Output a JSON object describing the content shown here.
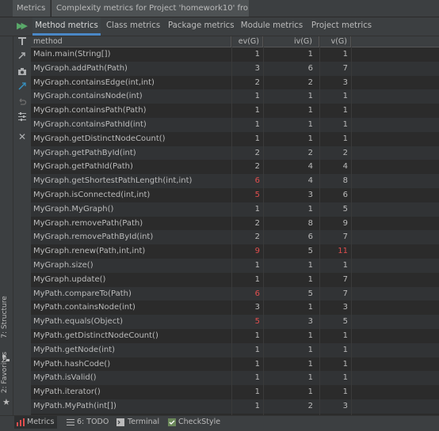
{
  "window_tabs": [
    {
      "label": "Metrics"
    },
    {
      "label": "Complexity metrics for Project 'homework10' fro..."
    }
  ],
  "metric_tabs": [
    {
      "label": "Method metrics",
      "active": true
    },
    {
      "label": "Class metrics"
    },
    {
      "label": "Package metrics"
    },
    {
      "label": "Module metrics"
    },
    {
      "label": "Project metrics"
    }
  ],
  "table": {
    "columns": [
      "method",
      "ev(G)",
      "iv(G)",
      "v(G)"
    ],
    "rows": [
      {
        "method": "Main.main(String[])",
        "ev": "1",
        "iv": "1",
        "v": "1"
      },
      {
        "method": "MyGraph.addPath(Path)",
        "ev": "3",
        "iv": "6",
        "v": "7"
      },
      {
        "method": "MyGraph.containsEdge(int,int)",
        "ev": "2",
        "iv": "2",
        "v": "3"
      },
      {
        "method": "MyGraph.containsNode(int)",
        "ev": "1",
        "iv": "1",
        "v": "1"
      },
      {
        "method": "MyGraph.containsPath(Path)",
        "ev": "1",
        "iv": "1",
        "v": "1"
      },
      {
        "method": "MyGraph.containsPathId(int)",
        "ev": "1",
        "iv": "1",
        "v": "1"
      },
      {
        "method": "MyGraph.getDistinctNodeCount()",
        "ev": "1",
        "iv": "1",
        "v": "1"
      },
      {
        "method": "MyGraph.getPathById(int)",
        "ev": "2",
        "iv": "2",
        "v": "2"
      },
      {
        "method": "MyGraph.getPathId(Path)",
        "ev": "2",
        "iv": "4",
        "v": "4"
      },
      {
        "method": "MyGraph.getShortestPathLength(int,int)",
        "ev": "6",
        "iv": "4",
        "v": "8",
        "ev_red": true
      },
      {
        "method": "MyGraph.isConnected(int,int)",
        "ev": "5",
        "iv": "3",
        "v": "6",
        "ev_red": true
      },
      {
        "method": "MyGraph.MyGraph()",
        "ev": "1",
        "iv": "1",
        "v": "5"
      },
      {
        "method": "MyGraph.removePath(Path)",
        "ev": "2",
        "iv": "8",
        "v": "9"
      },
      {
        "method": "MyGraph.removePathById(int)",
        "ev": "2",
        "iv": "6",
        "v": "7"
      },
      {
        "method": "MyGraph.renew(Path,int,int)",
        "ev": "9",
        "iv": "5",
        "v": "11",
        "ev_red": true,
        "v_red": true
      },
      {
        "method": "MyGraph.size()",
        "ev": "1",
        "iv": "1",
        "v": "1"
      },
      {
        "method": "MyGraph.update()",
        "ev": "1",
        "iv": "1",
        "v": "7"
      },
      {
        "method": "MyPath.compareTo(Path)",
        "ev": "6",
        "iv": "5",
        "v": "7",
        "ev_red": true
      },
      {
        "method": "MyPath.containsNode(int)",
        "ev": "3",
        "iv": "1",
        "v": "3"
      },
      {
        "method": "MyPath.equals(Object)",
        "ev": "5",
        "iv": "3",
        "v": "5",
        "ev_red": true
      },
      {
        "method": "MyPath.getDistinctNodeCount()",
        "ev": "1",
        "iv": "1",
        "v": "1"
      },
      {
        "method": "MyPath.getNode(int)",
        "ev": "1",
        "iv": "1",
        "v": "1"
      },
      {
        "method": "MyPath.hashCode()",
        "ev": "1",
        "iv": "1",
        "v": "1"
      },
      {
        "method": "MyPath.isValid()",
        "ev": "1",
        "iv": "1",
        "v": "1"
      },
      {
        "method": "MyPath.iterator()",
        "ev": "1",
        "iv": "1",
        "v": "1"
      },
      {
        "method": "MyPath.MyPath(int[])",
        "ev": "1",
        "iv": "2",
        "v": "3"
      }
    ]
  },
  "side_tools": {
    "structure": "7: Structure",
    "favorites": "2: Favorites"
  },
  "status_bar": [
    {
      "label": "Metrics",
      "active": true
    },
    {
      "label": "6: TODO"
    },
    {
      "label": "Terminal"
    },
    {
      "label": "CheckStyle"
    }
  ],
  "colors": {
    "background": "#2b2b2b",
    "panel": "#3c3f41",
    "accent": "#4a88c7",
    "warning_red": "#e04e4e",
    "run_green": "#59a869"
  },
  "icons": [
    "run-icon",
    "pin-icon",
    "export-icon",
    "camera-icon",
    "compare-icon",
    "undo-icon",
    "settings-icon",
    "close-icon",
    "structure-icon",
    "star-icon",
    "metrics-icon",
    "todo-icon",
    "terminal-icon",
    "checkstyle-icon"
  ]
}
